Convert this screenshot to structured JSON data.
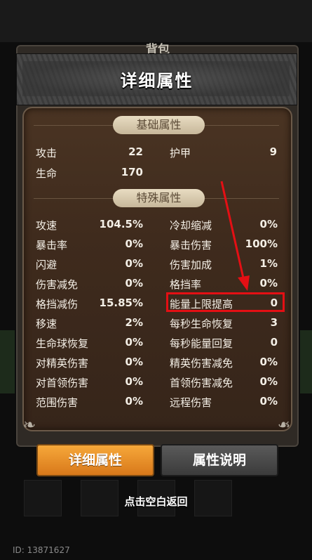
{
  "background": {
    "partial_title": "背包"
  },
  "header": {
    "title": "详细属性"
  },
  "sections": {
    "basic": "基础属性",
    "special": "特殊属性"
  },
  "basic_stats": [
    {
      "label": "攻击",
      "value": "22"
    },
    {
      "label": "护甲",
      "value": "9"
    },
    {
      "label": "生命",
      "value": "170"
    }
  ],
  "special_left": [
    {
      "label": "攻速",
      "value": "104.5%"
    },
    {
      "label": "暴击率",
      "value": "0%"
    },
    {
      "label": "闪避",
      "value": "0%"
    },
    {
      "label": "伤害减免",
      "value": "0%"
    },
    {
      "label": "格挡减伤",
      "value": "15.85%"
    },
    {
      "label": "移速",
      "value": "2%"
    },
    {
      "label": "生命球恢复",
      "value": "0%"
    },
    {
      "label": "对精英伤害",
      "value": "0%"
    },
    {
      "label": "对首领伤害",
      "value": "0%"
    },
    {
      "label": "范围伤害",
      "value": "0%"
    }
  ],
  "special_right": [
    {
      "label": "冷却缩减",
      "value": "0%"
    },
    {
      "label": "暴击伤害",
      "value": "100%"
    },
    {
      "label": "伤害加成",
      "value": "1%"
    },
    {
      "label": "格挡率",
      "value": "0%"
    },
    {
      "label": "能量上限提高",
      "value": "0"
    },
    {
      "label": "每秒生命恢复",
      "value": "3"
    },
    {
      "label": "每秒能量回复",
      "value": "0"
    },
    {
      "label": "精英伤害减免",
      "value": "0%"
    },
    {
      "label": "首领伤害减免",
      "value": "0%"
    },
    {
      "label": "远程伤害",
      "value": "0%"
    }
  ],
  "tabs": {
    "detail": "详细属性",
    "explain": "属性说明"
  },
  "hint": "点击空白返回",
  "footer": {
    "id_text": "ID: 13871627"
  },
  "colors": {
    "highlight": "#e40f14",
    "tab_active": "#f0a030"
  }
}
